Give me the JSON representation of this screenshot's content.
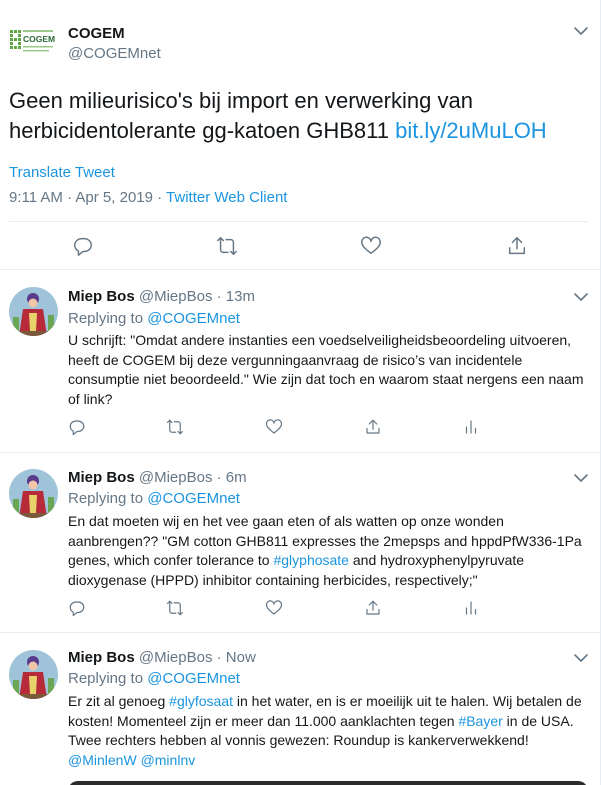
{
  "main_tweet": {
    "author_name": "COGEM",
    "author_handle": "@COGEMnet",
    "text": "Geen milieurisico's bij import en verwerking van herbicidentolerante gg-katoen GHB811 ",
    "link": "bit.ly/2uMuLOH",
    "translate_label": "Translate Tweet",
    "timestamp": "9:11 AM · Apr 5, 2019 · ",
    "client": "Twitter Web Client",
    "actions": [
      "reply-icon",
      "retweet-icon",
      "like-icon",
      "share-icon"
    ]
  },
  "replies": [
    {
      "author_name": "Miep Bos",
      "author_handle": "@MiepBos",
      "time": "13m",
      "replying_prefix": "Replying to ",
      "replying_to": "@COGEMnet",
      "text": "U schrijft: \"Omdat andere instanties een voedselveiligheidsbeoordeling uitvoeren, heeft de COGEM bij deze vergunningaanvraag de risico’s van incidentele consumptie niet beoordeeld.\" Wie zijn dat toch en waarom staat nergens een naam of link?"
    },
    {
      "author_name": "Miep Bos",
      "author_handle": "@MiepBos",
      "time": "6m",
      "replying_prefix": "Replying to ",
      "replying_to": "@COGEMnet",
      "text_part1": "En dat moeten wij en het vee gaan eten of als watten op onze wonden aanbrengen?? \"GM cotton GHB811 expresses the 2mepsps and hppdPfW336-1Pa genes, which confer tolerance to ",
      "hashtag": "#glyphosate",
      "text_part2": " and hydroxyphenylpyruvate dioxygenase (HPPD) inhibitor containing herbicides, respectively;\""
    },
    {
      "author_name": "Miep Bos",
      "author_handle": "@MiepBos",
      "time": "Now",
      "replying_prefix": "Replying to ",
      "replying_to": "@COGEMnet",
      "text_part1": "Er zit al genoeg ",
      "hashtag1": "#glyfosaat",
      "text_part2": " in het water, en is er moeilijk uit te halen. Wij betalen de kosten! Momenteel zijn er meer dan 11.000 aanklachten tegen ",
      "hashtag2": "#Bayer",
      "text_part3": " in de USA. Twee rechters hebben al vonnis gewezen: Roundup is kankerverwekkend! ",
      "mention1": "@MinlenW",
      "mention2": "@minlnv"
    }
  ],
  "reply_separator": " · ",
  "colors": {
    "link": "#1b95e0",
    "secondary_text": "#657786",
    "border": "#e6ecf0",
    "cogem_green": "#5fa843"
  }
}
